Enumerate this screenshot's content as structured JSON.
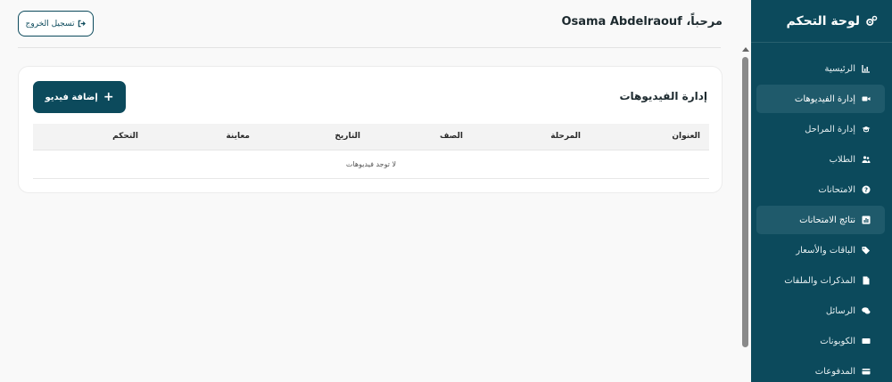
{
  "sidebar": {
    "title": "لوحة التحكم",
    "title_icon": "gears-icon",
    "items": [
      {
        "label": "الرئيسية",
        "icon": "chart-icon",
        "active": false
      },
      {
        "label": "إدارة الفيديوهات",
        "icon": "video-icon",
        "active": true
      },
      {
        "label": "إدارة المراحل",
        "icon": "graduation-cap-icon",
        "active": false
      },
      {
        "label": "الطلاب",
        "icon": "users-icon",
        "active": false
      },
      {
        "label": "الامتحانات",
        "icon": "question-circle-icon",
        "active": false
      },
      {
        "label": "نتائج الامتحانات",
        "icon": "poll-icon",
        "active": true
      },
      {
        "label": "الباقات والأسعار",
        "icon": "tags-icon",
        "active": false
      },
      {
        "label": "المذكرات والملفات",
        "icon": "file-icon",
        "active": false
      },
      {
        "label": "الرسائل",
        "icon": "comments-icon",
        "active": false
      },
      {
        "label": "الكوبونات",
        "icon": "ticket-icon",
        "active": false
      },
      {
        "label": "المدفوعات",
        "icon": "credit-card-icon",
        "active": false
      }
    ]
  },
  "header": {
    "greeting": "مرحباً، Osama Abdelraouf",
    "logout_label": "تسجيل الخروج",
    "logout_icon": "sign-out-icon"
  },
  "main": {
    "title": "إدارة الفيديوهات",
    "add_button_label": "إضافة فيديو",
    "add_button_icon": "plus-icon",
    "table": {
      "columns": [
        "العنوان",
        "المرحلة",
        "الصف",
        "التاريخ",
        "معاينة",
        "التحكم"
      ],
      "empty_message": "لا توجد فيديوهات"
    }
  },
  "colors": {
    "primary": "#0c4a5c",
    "active_item": "#1f5a6b",
    "background": "#f9f9f9"
  }
}
